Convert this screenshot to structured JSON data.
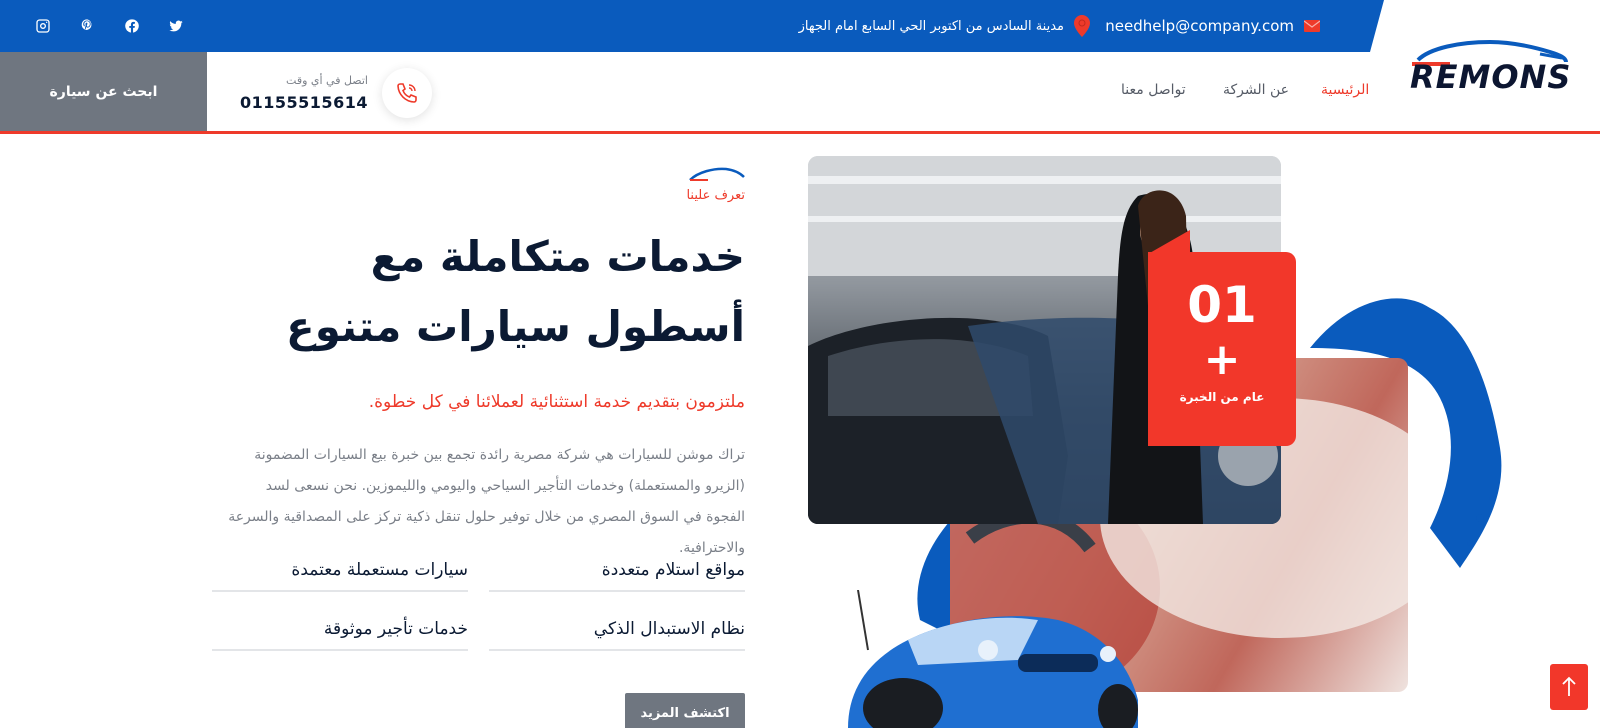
{
  "topbar": {
    "email": "needhelp@company.com",
    "address": "مدينة السادس من اكتوبر الحي السابع امام الجهاز"
  },
  "brand": {
    "logo_text": "REMONS"
  },
  "nav": {
    "items": [
      {
        "label": "الرئيسية",
        "active": true
      },
      {
        "label": "عن الشركة",
        "active": false
      },
      {
        "label": "تواصل معنا",
        "active": false
      }
    ]
  },
  "header": {
    "call_label": "اتصل في أي وقت",
    "phone": "01155515614",
    "search_button": "ابحث عن سيارة"
  },
  "about": {
    "eyebrow": "تعرف علينا",
    "title_line1": "خدمات متكاملة مع",
    "title_line2": "أسطول سيارات متنوع",
    "subtitle": "ملتزمون بتقديم خدمة استثنائية لعملائنا في كل خطوة.",
    "description": "تراك موشن للسيارات هي شركة مصرية رائدة تجمع بين خبرة بيع السيارات المضمونة (الزيرو والمستعملة) وخدمات التأجير السياحي واليومي والليموزين. نحن نسعى لسد الفجوة في السوق المصري من خلال توفير حلول تنقل ذكية تركز على المصداقية والسرعة والاحترافية.",
    "features": [
      "مواقع استلام متعددة",
      "سيارات مستعملة معتمدة",
      "نظام الاستبدال الذكي",
      "خدمات تأجير موثوقة"
    ],
    "more_button": "اكتشف المزيد"
  },
  "experience": {
    "number": "01",
    "plus": "+",
    "label": "عام من الخبرة"
  },
  "colors": {
    "primary_blue": "#0a5bbd",
    "accent_red": "#ee3a2a",
    "button_gray": "#6f7680"
  }
}
